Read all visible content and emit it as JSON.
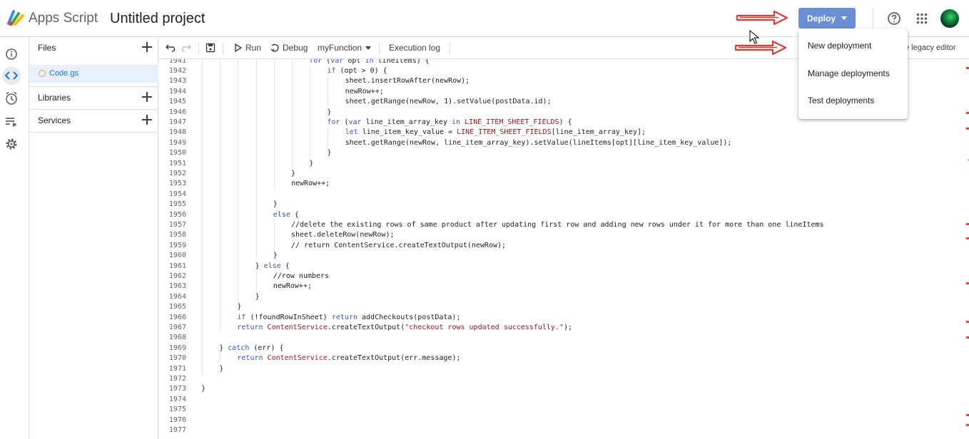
{
  "header": {
    "app_name": "Apps Script",
    "project_title": "Untitled project",
    "deploy_label": "Deploy"
  },
  "rail": {
    "icons": [
      "info-icon",
      "code-icon",
      "clock-icon",
      "executions-icon",
      "gear-icon"
    ]
  },
  "files_panel": {
    "files_label": "Files",
    "file_name": "Code.gs",
    "libraries_label": "Libraries",
    "services_label": "Services"
  },
  "toolbar": {
    "run_label": "Run",
    "debug_label": "Debug",
    "function_name": "myFunction",
    "execution_log_label": "Execution log",
    "legacy_label": "e legacy editor"
  },
  "deploy_menu": {
    "items": [
      "New deployment",
      "Manage deployments",
      "Test deployments"
    ]
  },
  "colors": {
    "deploy_button": "#6a8fd6",
    "annotation_arrow": "#e53935",
    "error_marker": "#f44336"
  },
  "code": {
    "lines": [
      {
        "n": "1941",
        "text": "for (var opt in lineItems) {"
      },
      {
        "n": "1942",
        "text": "if (opt > 0) {"
      },
      {
        "n": "1943",
        "text": "sheet.insertRowAfter(newRow);"
      },
      {
        "n": "1944",
        "text": "newRow++;"
      },
      {
        "n": "1945",
        "text": "sheet.getRange(newRow, 1).setValue(postData.id);"
      },
      {
        "n": "1946",
        "text": "}"
      },
      {
        "n": "1947",
        "text": "for (var line_item_array_key in LINE_ITEM_SHEET_FIELDS) {"
      },
      {
        "n": "1948",
        "text": "let line_item_key_value = LINE_ITEM_SHEET_FIELDS[line_item_array_key];"
      },
      {
        "n": "1949",
        "text": "sheet.getRange(newRow, line_item_array_key).setValue(lineItems[opt][line_item_key_value]);"
      },
      {
        "n": "1950",
        "text": "}"
      },
      {
        "n": "1951",
        "text": "}"
      },
      {
        "n": "1952",
        "text": "}"
      },
      {
        "n": "1953",
        "text": "newRow++;"
      },
      {
        "n": "1954",
        "text": ""
      },
      {
        "n": "1955",
        "text": "}"
      },
      {
        "n": "1956",
        "text": "else {"
      },
      {
        "n": "1957",
        "text": "//delete the existing rows of same product after updating first row and adding new rows under it for more than one lineItems"
      },
      {
        "n": "1958",
        "text": "sheet.deleteRow(newRow);"
      },
      {
        "n": "1959",
        "text": "// return ContentService.createTextOutput(newRow);"
      },
      {
        "n": "1960",
        "text": "}"
      },
      {
        "n": "1961",
        "text": "} else {"
      },
      {
        "n": "1962",
        "text": "//row numbers"
      },
      {
        "n": "1963",
        "text": "newRow++;"
      },
      {
        "n": "1964",
        "text": "}"
      },
      {
        "n": "1965",
        "text": "}"
      },
      {
        "n": "1966",
        "text": "if (!foundRowInSheet) return addCheckouts(postData);"
      },
      {
        "n": "1967",
        "text": "return ContentService.createTextOutput(\"checkout rows updated successfully.\");"
      },
      {
        "n": "1968",
        "text": ""
      },
      {
        "n": "1969",
        "text": "} catch (err) {"
      },
      {
        "n": "1970",
        "text": "return ContentService.createTextOutput(err.message);"
      },
      {
        "n": "1971",
        "text": "}"
      },
      {
        "n": "1972",
        "text": ""
      },
      {
        "n": "1973",
        "text": "}"
      },
      {
        "n": "1974",
        "text": ""
      },
      {
        "n": "1975",
        "text": ""
      },
      {
        "n": "1976",
        "text": ""
      },
      {
        "n": "1977",
        "text": ""
      }
    ]
  }
}
